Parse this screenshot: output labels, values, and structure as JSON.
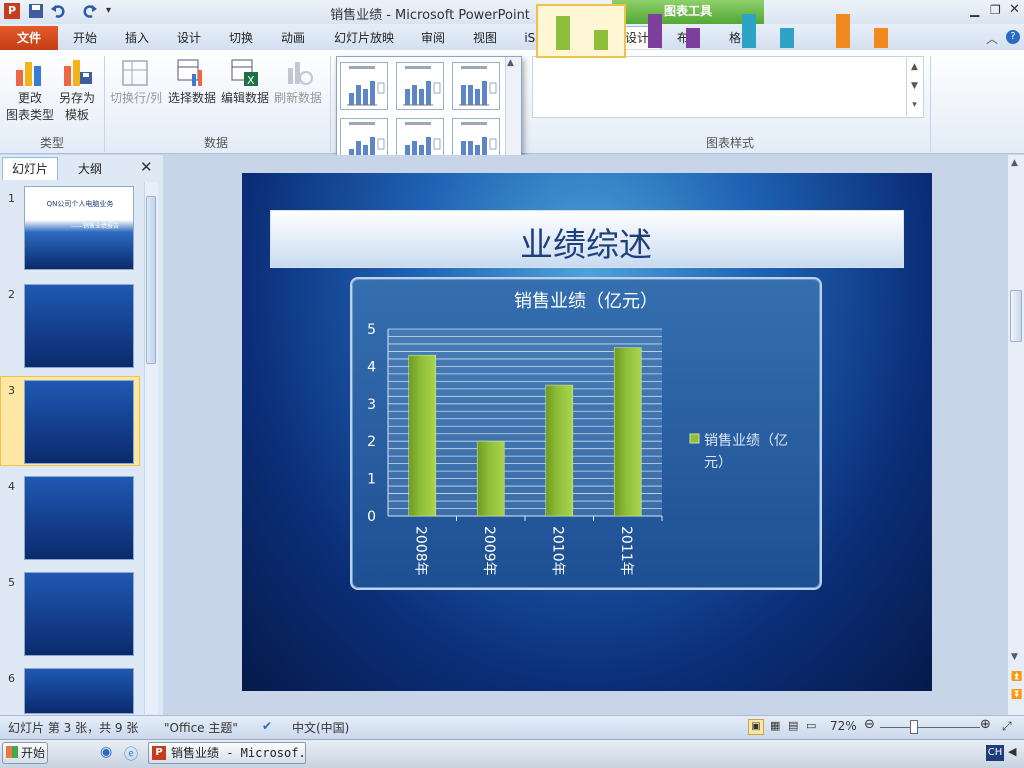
{
  "window": {
    "title": "销售业绩  -  Microsoft PowerPoint",
    "context_tab_group": "图表工具"
  },
  "tabs": [
    "文件",
    "开始",
    "插入",
    "设计",
    "切换",
    "动画",
    "幻灯片放映",
    "审阅",
    "视图",
    "iSpring Free",
    "设计",
    "布局",
    "格式"
  ],
  "ribbon": {
    "change_type": "更改\n图表类型",
    "save_template": "另存为\n模板",
    "switch_row_col": "切换行/列",
    "select_data": "选择数据",
    "edit_data": "编辑数据",
    "refresh_data": "刷新数据",
    "group_type": "类型",
    "group_data": "数据",
    "group_styles": "图表样式"
  },
  "colors": {
    "accent_green": "#8fbf3a",
    "style_purple": "#7d3f9c",
    "style_teal": "#2fa3c4",
    "style_orange": "#f08a1e"
  },
  "pane": {
    "tab_slides": "幻灯片",
    "tab_outline": "大纲",
    "slide_numbers": [
      "1",
      "2",
      "3",
      "4",
      "5",
      "6"
    ],
    "slide1_title": "QN公司个人电脑业务",
    "slide1_sub": "——销售业绩报告"
  },
  "slide": {
    "title": "业绩综述"
  },
  "chart_data": {
    "type": "bar",
    "title": "销售业绩（亿元）",
    "categories": [
      "2008年",
      "2009年",
      "2010年",
      "2011年"
    ],
    "series": [
      {
        "name": "销售业绩（亿元）",
        "values": [
          4.3,
          2.0,
          3.5,
          4.5
        ]
      }
    ],
    "ylim": [
      0,
      5
    ],
    "yticks": [
      "0",
      "1",
      "2",
      "3",
      "4",
      "5"
    ],
    "grid": true,
    "legend": "right"
  },
  "status": {
    "slide_info": "幻灯片 第 3 张，共 9 张",
    "theme": "\"Office 主题\"",
    "language": "中文(中国)",
    "zoom": "72%"
  },
  "taskbar": {
    "start": "开始",
    "app": "销售业绩 - Microsof...",
    "ime": "CH"
  }
}
